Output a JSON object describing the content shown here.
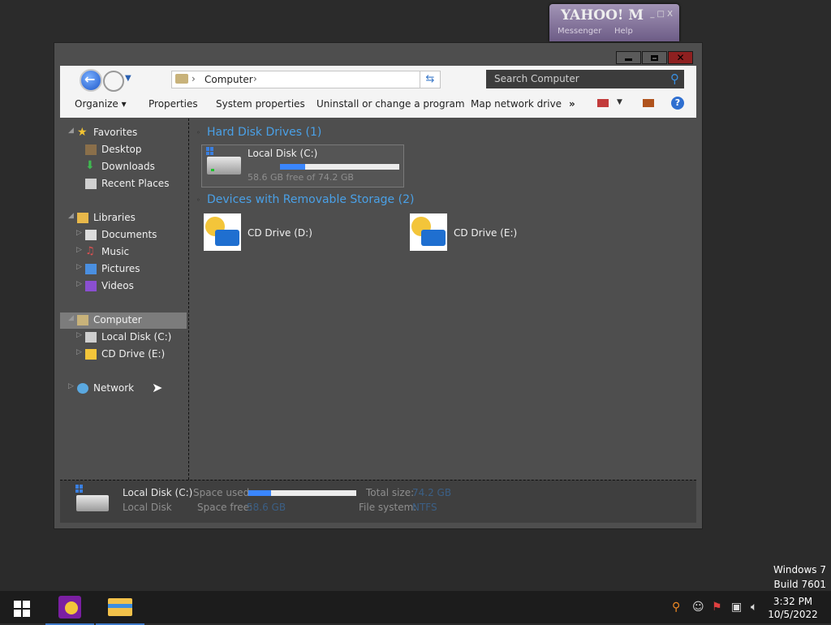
{
  "yahoo": {
    "logo": "YAHOO! M",
    "controls": "_ □ X",
    "subtitle": "Messenger",
    "help": "Help"
  },
  "window": {
    "buttons": {
      "minimize": "–",
      "maximize": "□",
      "close": "×"
    }
  },
  "address": {
    "crumb": "Computer",
    "search_placeholder": "Search Computer"
  },
  "commands": {
    "organize": "Organize ▾",
    "properties": "Properties",
    "system_properties": "System properties",
    "uninstall": "Uninstall or change a program",
    "map_drive": "Map network drive",
    "more": "»",
    "help": "?"
  },
  "nav": {
    "favorites": "Favorites",
    "desktop": "Desktop",
    "downloads": "Downloads",
    "recent": "Recent Places",
    "libraries": "Libraries",
    "documents": "Documents",
    "music": "Music",
    "pictures": "Pictures",
    "videos": "Videos",
    "computer": "Computer",
    "local_disk": "Local Disk (C:)",
    "cd_drive_e": "CD Drive (E:)",
    "network": "Network"
  },
  "content": {
    "hdd_group": "Hard Disk Drives (1)",
    "removable_group": "Devices with Removable Storage (2)",
    "local_disk": {
      "name": "Local Disk (C:)",
      "free_text": "58.6 GB free of 74.2 GB",
      "used_fraction": 0.21
    },
    "cd_d": "CD Drive (D:)",
    "cd_e": "CD Drive (E:)"
  },
  "details": {
    "name": "Local Disk (C:)",
    "type": "Local Disk",
    "space_used_label": "Space used:",
    "space_free_label": "Space free:",
    "space_free_value": "58.6 GB",
    "total_size_label": "Total size:",
    "total_size_value": "74.2 GB",
    "file_system_label": "File system:",
    "file_system_value": "NTFS"
  },
  "taskbar": {
    "time": "3:32 PM",
    "date": "10/5/2022"
  },
  "watermark": {
    "line1": "Windows 7",
    "line2": "Build 7601"
  },
  "colors": {
    "accent": "#4aa0e6",
    "window_bg": "#4e4e4e",
    "desktop_bg": "#2b2b2b"
  }
}
